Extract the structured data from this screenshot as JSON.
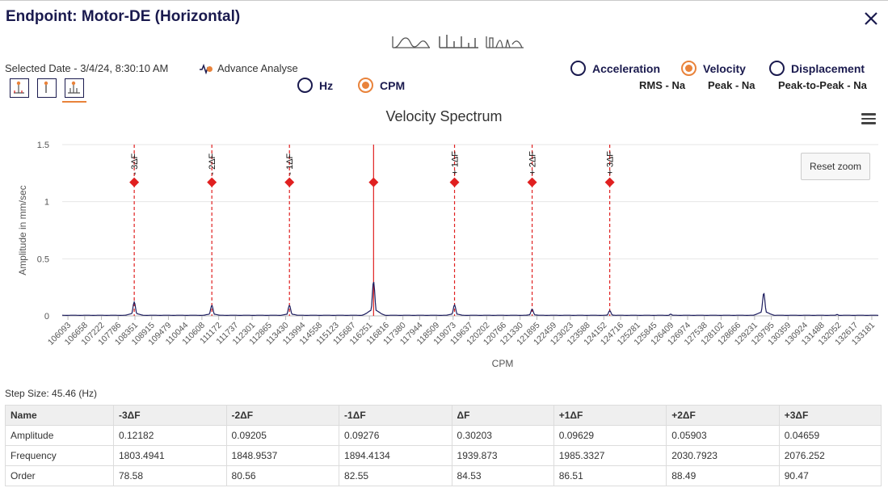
{
  "title": "Endpoint: Motor-DE (Horizontal)",
  "selected_date": "Selected Date - 3/4/24, 8:30:10 AM",
  "advance_analyse": "Advance Analyse",
  "units": {
    "hz": "Hz",
    "cpm": "CPM",
    "selected": "CPM"
  },
  "measures": {
    "acceleration": "Acceleration",
    "velocity": "Velocity",
    "displacement": "Displacement",
    "selected": "Velocity",
    "rms": "RMS - Na",
    "peak": "Peak - Na",
    "peak_to_peak": "Peak-to-Peak - Na"
  },
  "chart": {
    "reset_zoom": "Reset zoom",
    "menu_icon": "hamburger-menu-icon"
  },
  "chart_data": {
    "type": "line",
    "title": "Velocity Spectrum",
    "xlabel": "CPM",
    "ylabel": "Amplitude in mm/sec",
    "ylim": [
      0,
      1.5
    ],
    "yticks": [
      "1.5",
      "1",
      "0.5",
      "0"
    ],
    "xlim": [
      105900,
      133400
    ],
    "xticks": [
      "106093",
      "106658",
      "107222",
      "107786",
      "108351",
      "108915",
      "109479",
      "110044",
      "110608",
      "111172",
      "111737",
      "112301",
      "112865",
      "113430",
      "113994",
      "114558",
      "115123",
      "115687",
      "116251",
      "116816",
      "117380",
      "117944",
      "118509",
      "119073",
      "119637",
      "120202",
      "120766",
      "121330",
      "121895",
      "122459",
      "123023",
      "123588",
      "124152",
      "124716",
      "125281",
      "125845",
      "126409",
      "126974",
      "127538",
      "128102",
      "128666",
      "129231",
      "129795",
      "130359",
      "130924",
      "131488",
      "132052",
      "132617",
      "133181"
    ],
    "series": [
      {
        "peaks": [
          {
            "x": 108327,
            "y": 0.12182
          },
          {
            "x": 110942,
            "y": 0.09205
          },
          {
            "x": 113557,
            "y": 0.09276
          },
          {
            "x": 116392,
            "y": 0.30203
          },
          {
            "x": 119120,
            "y": 0.09629
          },
          {
            "x": 121735,
            "y": 0.05903
          },
          {
            "x": 124350,
            "y": 0.04659
          },
          {
            "x": 126405,
            "y": 0.015
          },
          {
            "x": 129540,
            "y": 0.2
          },
          {
            "x": 132010,
            "y": 0.012
          }
        ]
      }
    ],
    "sideband_markers": [
      {
        "label": "- 3ΔF",
        "x": 108327
      },
      {
        "label": "- 2ΔF",
        "x": 110942
      },
      {
        "label": "- 1ΔF",
        "x": 113557
      },
      {
        "label": "",
        "x": 116392
      },
      {
        "label": "+ 1ΔF",
        "x": 119120
      },
      {
        "label": "+ 2ΔF",
        "x": 121735
      },
      {
        "label": "+ 3ΔF",
        "x": 124350
      }
    ],
    "marker_y": 1.17
  },
  "step_size": "Step Size: 45.46 (Hz)",
  "table": {
    "headers": [
      "Name",
      "-3ΔF",
      "-2ΔF",
      "-1ΔF",
      "ΔF",
      "+1ΔF",
      "+2ΔF",
      "+3ΔF"
    ],
    "rows": [
      [
        "Amplitude",
        "0.12182",
        "0.09205",
        "0.09276",
        "0.30203",
        "0.09629",
        "0.05903",
        "0.04659"
      ],
      [
        "Frequency",
        "1803.4941",
        "1848.9537",
        "1894.4134",
        "1939.873",
        "1985.3327",
        "2030.7923",
        "2076.252"
      ],
      [
        "Order",
        "78.58",
        "80.56",
        "82.55",
        "84.53",
        "86.51",
        "88.49",
        "90.47"
      ]
    ]
  },
  "colors": {
    "accent": "#e9833b",
    "navy": "#1a1a4e",
    "marker": "#e02020",
    "line": "#1c1c5e"
  }
}
